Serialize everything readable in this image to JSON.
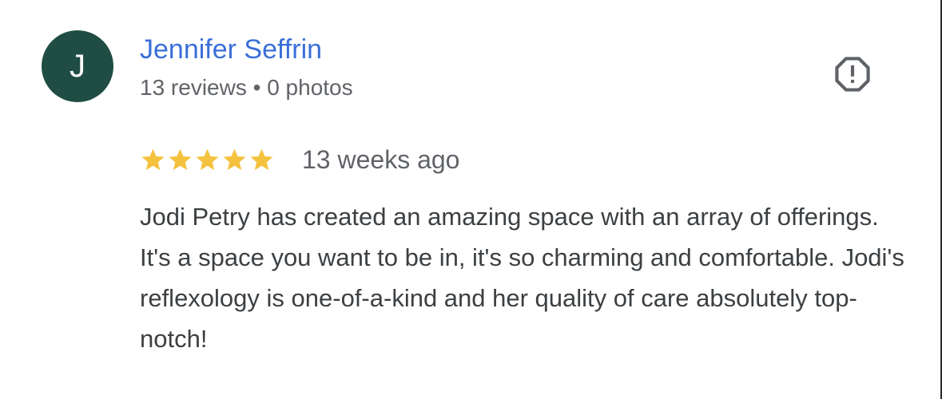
{
  "reviewer": {
    "initial": "J",
    "name": "Jennifer Seffrin",
    "meta": "13 reviews • 0 photos",
    "avatar_color": "#1f4d44",
    "name_color": "#3a6fd8"
  },
  "report": {
    "icon": "report-octagon-icon"
  },
  "review": {
    "rating": 5,
    "max_rating": 5,
    "star_color": "#f4c23f",
    "date": "13 weeks ago",
    "text": "Jodi Petry has created an amazing space with an array of offerings. It's a space you want to be in, it's so charming and comfortable. Jodi's reflexology is one-of-a-kind and her quality of care absolutely top-notch!"
  }
}
